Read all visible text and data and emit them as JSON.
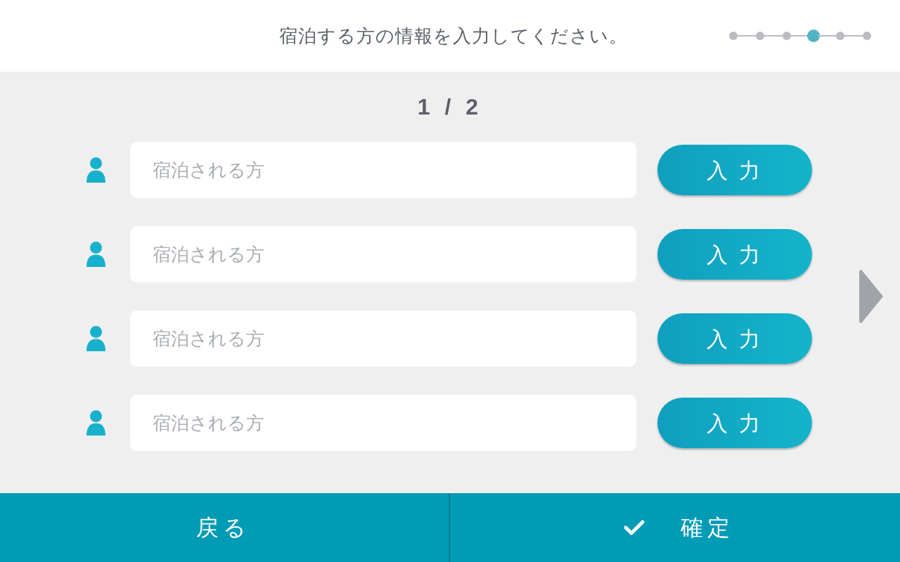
{
  "header": {
    "title": "宿泊する方の情報を入力してください。",
    "steps": [
      {
        "selected": false
      },
      {
        "selected": false
      },
      {
        "selected": false
      },
      {
        "selected": true
      },
      {
        "selected": false
      },
      {
        "selected": false
      }
    ]
  },
  "page_indicator": "1 / 2",
  "guests": [
    {
      "placeholder": "宿泊される方",
      "button": "入 力"
    },
    {
      "placeholder": "宿泊される方",
      "button": "入 力"
    },
    {
      "placeholder": "宿泊される方",
      "button": "入 力"
    },
    {
      "placeholder": "宿泊される方",
      "button": "入 力"
    }
  ],
  "footer": {
    "back": "戻る",
    "confirm": "確定"
  }
}
